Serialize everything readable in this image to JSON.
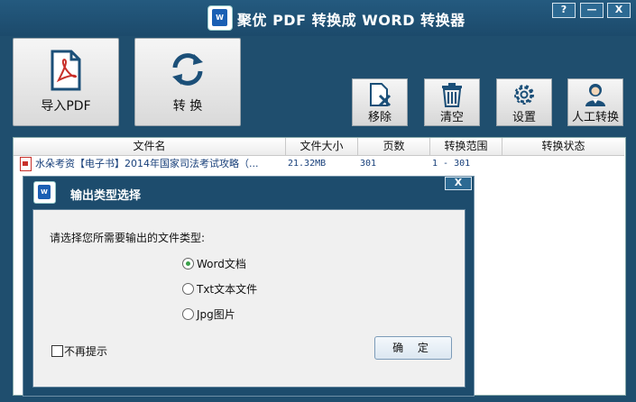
{
  "window": {
    "title": "聚优 PDF 转换成 WORD 转换器",
    "help_label": "?",
    "min_label": "—",
    "close_label": "X"
  },
  "toolbar": {
    "import_label": "导入PDF",
    "convert_label": "转 换",
    "remove_label": "移除",
    "clear_label": "清空",
    "settings_label": "设置",
    "human_label": "人工转换"
  },
  "table": {
    "columns": [
      "文件名",
      "文件大小",
      "页数",
      "转换范围",
      "转换状态"
    ],
    "rows": [
      {
        "name": "水朵考资【电子书】2014年国家司法考试攻略（...",
        "size": "21.32MB",
        "pages": "301",
        "range": "1 - 301",
        "status": ""
      }
    ]
  },
  "dialog": {
    "title": "输出类型选择",
    "close_label": "X",
    "prompt": "请选择您所需要输出的文件类型:",
    "options": [
      "Word文档",
      "Txt文本文件",
      "Jpg图片"
    ],
    "selected": "Word文档",
    "checkbox_label": "不再提示",
    "ok_label": "确 定"
  },
  "colors": {
    "frame": "#1f4e6e",
    "accent": "#1a5fb4",
    "pdf_red": "#c8302a"
  }
}
